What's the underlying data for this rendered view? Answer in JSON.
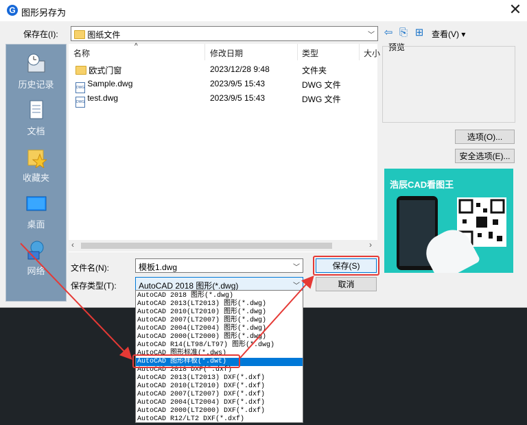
{
  "title": "图形另存为",
  "close_symbol": "✕",
  "save_in": {
    "label": "保存在(I):",
    "value": "图纸文件"
  },
  "toolbar": {
    "view_label": "查看(V) ▾"
  },
  "places": [
    {
      "label": "历史记录",
      "icon": "history-icon"
    },
    {
      "label": "文档",
      "icon": "documents-icon"
    },
    {
      "label": "收藏夹",
      "icon": "favorites-icon"
    },
    {
      "label": "桌面",
      "icon": "desktop-icon"
    },
    {
      "label": "网络",
      "icon": "network-icon"
    }
  ],
  "columns": {
    "name": "名称",
    "date": "修改日期",
    "type": "类型",
    "size": "大小"
  },
  "files": [
    {
      "name": "欧式门窗",
      "date": "2023/12/28 9:48",
      "type": "文件夹",
      "icon": "folder-icon"
    },
    {
      "name": "Sample.dwg",
      "date": "2023/9/5 15:43",
      "type": "DWG 文件",
      "icon": "dwg-file-icon"
    },
    {
      "name": "test.dwg",
      "date": "2023/9/5 15:43",
      "type": "DWG 文件",
      "icon": "dwg-file-icon"
    }
  ],
  "dwg_icon_text": "DWG",
  "preview_label": "预览",
  "buttons": {
    "options": "选项(O)...",
    "security": "安全选项(E)...",
    "save": "保存(S)",
    "cancel": "取消"
  },
  "filename": {
    "label": "文件名(N):",
    "value": "模板1.dwg"
  },
  "filetype": {
    "label": "保存类型(T):",
    "value": "AutoCAD 2018 图形(*.dwg)",
    "options": [
      "AutoCAD 2018 图形(*.dwg)",
      "AutoCAD 2013(LT2013) 图形(*.dwg)",
      "AutoCAD 2010(LT2010) 图形(*.dwg)",
      "AutoCAD 2007(LT2007) 图形(*.dwg)",
      "AutoCAD 2004(LT2004) 图形(*.dwg)",
      "AutoCAD 2000(LT2000) 图形(*.dwg)",
      "AutoCAD R14(LT98/LT97) 图形(*.dwg)",
      "AutoCAD 图形标准(*.dws)",
      "AutoCAD 图形样板(*.dwt)",
      "AutoCAD 2018 DXF(*.dxf)",
      "AutoCAD 2013(LT2013) DXF(*.dxf)",
      "AutoCAD 2010(LT2010) DXF(*.dxf)",
      "AutoCAD 2007(LT2007) DXF(*.dxf)",
      "AutoCAD 2004(LT2004) DXF(*.dxf)",
      "AutoCAD 2000(LT2000) DXF(*.dxf)",
      "AutoCAD R12/LT2 DXF(*.dxf)"
    ],
    "selected_index": 8
  },
  "ad": {
    "brand": "浩辰CAD看图王"
  },
  "colors": {
    "accent": "#0078d7",
    "highlight": "#e53935",
    "ad_bg": "#20c6bc",
    "places_bg": "#7c98b3"
  }
}
